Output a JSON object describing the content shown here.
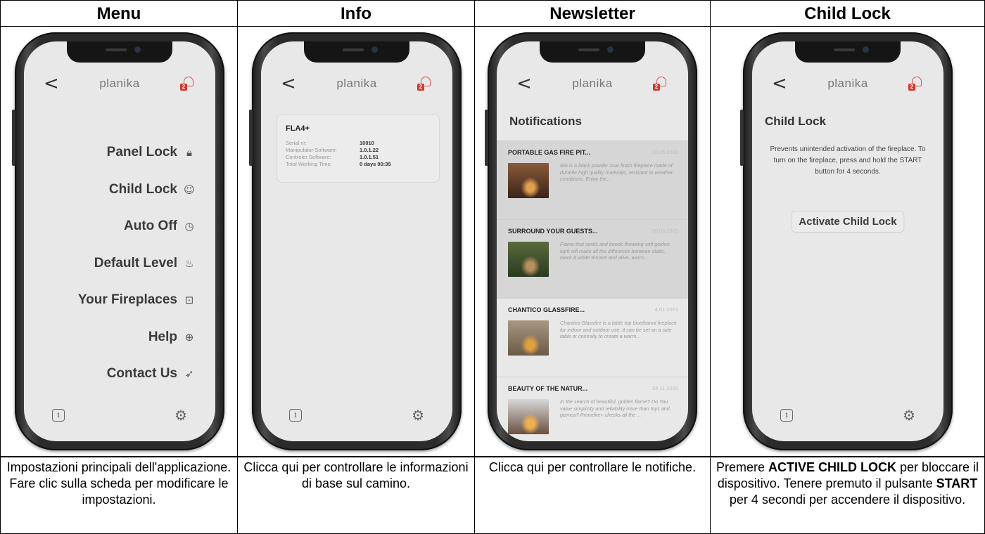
{
  "headers": [
    "Menu",
    "Info",
    "Newsletter",
    "Child Lock"
  ],
  "captions": [
    {
      "text": "Impostazioni principali dell'applicazione. Fare clic sulla scheda per modificare le impostazioni."
    },
    {
      "text": "Clicca qui per controllare le informazioni di base sul camino."
    },
    {
      "text": "Clicca qui per controllare le notifiche."
    },
    {
      "parts": [
        "Premere ",
        "ACTIVE CHILD LOCK",
        " per bloccare il dispositivo. Tenere premuto il pulsante ",
        "START",
        " per 4 secondi per accendere il dispositivo."
      ]
    }
  ],
  "app": {
    "brand": "planika",
    "back": "<",
    "notification_count": "2",
    "info_icon": "i",
    "gear_icon": "⚙"
  },
  "menu": {
    "items": [
      {
        "label": "Panel Lock",
        "icon": "lock-icon",
        "glyph": "🔒︎"
      },
      {
        "label": "Child Lock",
        "icon": "child-icon",
        "glyph": "☺"
      },
      {
        "label": "Auto Off",
        "icon": "clock-icon",
        "glyph": "◷"
      },
      {
        "label": "Default Level",
        "icon": "flame-icon",
        "glyph": "♨"
      },
      {
        "label": "Your Fireplaces",
        "icon": "fireplace-icon",
        "glyph": "⊡"
      },
      {
        "label": "Help",
        "icon": "help-icon",
        "glyph": "⊕"
      },
      {
        "label": "Contact Us",
        "icon": "send-icon",
        "glyph": "➶"
      }
    ]
  },
  "info": {
    "device": "FLA4+",
    "rows": [
      {
        "key": "Serial nr:",
        "value": "10010"
      },
      {
        "key": "Manipulator Software:",
        "value": "1.0.1.22"
      },
      {
        "key": "Controler Software:",
        "value": "1.0.1.51"
      },
      {
        "key": "Total Working Time:",
        "value": "0 days  00:35"
      }
    ]
  },
  "newsletter": {
    "title": "Notifications",
    "items": [
      {
        "title": "PORTABLE GAS FIRE PIT...",
        "date": "13.05.2021",
        "text": "Rio is a black powder coat finish fireplace made of durable high quality materials, resistant to weather conditions. Enjoy the...",
        "read": true,
        "img_colors": [
          "#8a5a3a",
          "#3a2418",
          "#e0a050"
        ]
      },
      {
        "title": "SURROUND YOUR GUESTS...",
        "date": "20.03.2021",
        "text": "Flame that swirls and bends throwing soft golden light will make all the difference between static, black & white terrace and alive, warm...",
        "read": true,
        "img_colors": [
          "#5a6a3a",
          "#2a3a20",
          "#b89060"
        ]
      },
      {
        "title": "CHANTICO GLASSFIRE...",
        "date": "4.01.2021",
        "text": "Chantico Glassfire is a table top bioethanol fireplace for indoor and outdoor use. It can be set on a side table or centrally to create a warm...",
        "read": false,
        "img_colors": [
          "#a89880",
          "#6a5a48",
          "#e0a040"
        ]
      },
      {
        "title": "BEAUTY OF THE NATUR...",
        "date": "24.11.2020",
        "text": "In the search of beautiful, golden flame? Do You value simplicity and reliability more than toys and gizmos? Primefire+ checks all the ...",
        "read": false,
        "img_colors": [
          "#d8d8d8",
          "#6a5040",
          "#f0b050"
        ]
      }
    ]
  },
  "childlock": {
    "title": "Child Lock",
    "description": "Prevents unintended activation of the fireplace. To turn on the fireplace, press and hold the START button for 4 seconds.",
    "button": "Activate Child Lock"
  }
}
